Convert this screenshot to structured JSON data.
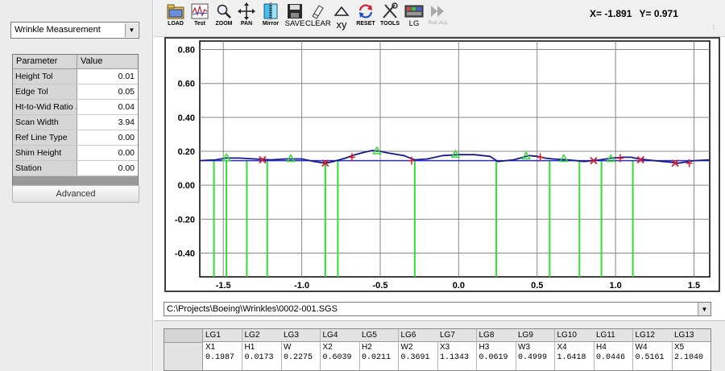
{
  "mode_select": {
    "value": "Wrinkle Measurement"
  },
  "param_table": {
    "headers": [
      "Parameter",
      "Value"
    ],
    "rows": [
      {
        "name": "Height Tol",
        "value": "0.01"
      },
      {
        "name": "Edge Tol",
        "value": "0.05"
      },
      {
        "name": "Ht-to-Wid Ratio ...",
        "value": "0.04"
      },
      {
        "name": "Scan Width",
        "value": "3.94"
      },
      {
        "name": "Ref Line Type",
        "value": "0.00"
      },
      {
        "name": "Shim Height",
        "value": "0.00"
      },
      {
        "name": "Station",
        "value": "0.00"
      }
    ]
  },
  "advanced_label": "Advanced",
  "toolbar": {
    "tools": [
      {
        "id": "load",
        "label": "LOAD",
        "icon": "folder-icon"
      },
      {
        "id": "test",
        "label": "Test",
        "icon": "signal-wave-icon"
      },
      {
        "id": "zoom",
        "label": "ZOOM",
        "icon": "magnifier-icon"
      },
      {
        "id": "pan",
        "label": "PAN",
        "icon": "four-arrows-icon"
      },
      {
        "id": "mirror",
        "label": "Mirror",
        "icon": "mirror-icon"
      },
      {
        "id": "save",
        "label": "SAVE",
        "icon": "floppy-disk-icon"
      },
      {
        "id": "clear",
        "label": "CLEAR",
        "icon": "eraser-icon"
      },
      {
        "id": "xy",
        "label": "xy",
        "icon": "triangle-icon"
      },
      {
        "id": "reset",
        "label": "RESET",
        "icon": "refresh-arrows-icon"
      },
      {
        "id": "tools",
        "label": "TOOLS",
        "icon": "tools-icon"
      },
      {
        "id": "lg",
        "label": "LG",
        "icon": "lg-panel-icon"
      },
      {
        "id": "run_all",
        "label": "Run ALL",
        "icon": "fast-forward-icon"
      }
    ],
    "coord_x": "X= -1.891",
    "coord_y": "Y= 0.971"
  },
  "file_path": "C:\\Projects\\Boeing\\Wrinkles\\0002-001.SGS",
  "results": {
    "columns": [
      {
        "lg": "LG1",
        "name": "X1",
        "value": "0.1987"
      },
      {
        "lg": "LG2",
        "name": "H1",
        "value": "0.0173"
      },
      {
        "lg": "LG3",
        "name": "W",
        "value": "0.2275"
      },
      {
        "lg": "LG4",
        "name": "X2",
        "value": "0.6039"
      },
      {
        "lg": "LG5",
        "name": "H2",
        "value": "0.0211"
      },
      {
        "lg": "LG6",
        "name": "W2",
        "value": "0.3691"
      },
      {
        "lg": "LG7",
        "name": "X3",
        "value": "1.1343"
      },
      {
        "lg": "LG8",
        "name": "H3",
        "value": "0.0619"
      },
      {
        "lg": "LG9",
        "name": "W3",
        "value": "0.4999"
      },
      {
        "lg": "LG10",
        "name": "X4",
        "value": "1.6418"
      },
      {
        "lg": "LG11",
        "name": "H4",
        "value": "0.0446"
      },
      {
        "lg": "LG12",
        "name": "W4",
        "value": "0.5161"
      },
      {
        "lg": "LG13",
        "name": "X5",
        "value": "2.1040"
      }
    ]
  },
  "colors": {
    "profile": "#1a1a8c",
    "reference_line": "#2a2ae0",
    "green": "#33dd33",
    "red": "#d81b2a",
    "grid": "#888888"
  },
  "chart_data": {
    "type": "line",
    "xlim": [
      -1.65,
      1.6
    ],
    "ylim": [
      -0.54,
      0.85
    ],
    "x_ticks": [
      "-1.5",
      "-1.0",
      "-0.5",
      "0.0",
      "0.5",
      "1.0",
      "1.5"
    ],
    "x_tick_values": [
      -1.5,
      -1.0,
      -0.5,
      0.0,
      0.5,
      1.0,
      1.5
    ],
    "y_ticks": [
      "0.80",
      "0.60",
      "0.40",
      "0.20",
      "0.00",
      "-0.20",
      "-0.40"
    ],
    "y_tick_values": [
      0.8,
      0.6,
      0.4,
      0.2,
      0.0,
      -0.2,
      -0.4
    ],
    "grid": true,
    "profile": {
      "x": [
        -1.65,
        -1.55,
        -1.48,
        -1.4,
        -1.3,
        -1.2,
        -1.1,
        -1.0,
        -0.92,
        -0.85,
        -0.8,
        -0.72,
        -0.66,
        -0.6,
        -0.55,
        -0.5,
        -0.45,
        -0.35,
        -0.28,
        -0.2,
        -0.1,
        0.0,
        0.1,
        0.2,
        0.25,
        0.3,
        0.35,
        0.45,
        0.5,
        0.55,
        0.6,
        0.7,
        0.8,
        0.85,
        0.9,
        0.98,
        1.05,
        1.1,
        1.15,
        1.2,
        1.3,
        1.36,
        1.4,
        1.5,
        1.6
      ],
      "y": [
        0.145,
        0.15,
        0.16,
        0.16,
        0.155,
        0.15,
        0.155,
        0.155,
        0.14,
        0.13,
        0.14,
        0.16,
        0.18,
        0.195,
        0.205,
        0.2,
        0.19,
        0.175,
        0.15,
        0.155,
        0.175,
        0.18,
        0.18,
        0.17,
        0.14,
        0.145,
        0.15,
        0.175,
        0.17,
        0.16,
        0.155,
        0.15,
        0.14,
        0.145,
        0.15,
        0.16,
        0.165,
        0.165,
        0.155,
        0.15,
        0.14,
        0.135,
        0.13,
        0.145,
        0.15
      ]
    },
    "reference_line": {
      "x": [
        -1.65,
        1.6
      ],
      "y": [
        0.145,
        0.145
      ]
    },
    "green_lines": [
      -1.56,
      -1.48,
      -1.35,
      -1.22,
      -0.85,
      -0.77,
      -0.28,
      0.24,
      0.58,
      0.77,
      0.91,
      1.11
    ],
    "green_lines_bottom": -0.54,
    "green_markers": [
      {
        "x": -1.48,
        "y": 0.16
      },
      {
        "x": -1.07,
        "y": 0.155
      },
      {
        "x": -0.52,
        "y": 0.2
      },
      {
        "x": -0.02,
        "y": 0.18
      },
      {
        "x": 0.43,
        "y": 0.17
      },
      {
        "x": 0.67,
        "y": 0.155
      },
      {
        "x": 0.97,
        "y": 0.155
      }
    ],
    "red_x_markers": [
      {
        "x": -1.25,
        "y": 0.15
      },
      {
        "x": -0.85,
        "y": 0.13
      },
      {
        "x": 0.86,
        "y": 0.145
      },
      {
        "x": 1.16,
        "y": 0.15
      },
      {
        "x": 1.38,
        "y": 0.13
      }
    ],
    "red_tick_markers": [
      {
        "x": -0.68,
        "y": 0.165
      },
      {
        "x": -0.3,
        "y": 0.145
      },
      {
        "x": 0.52,
        "y": 0.165
      },
      {
        "x": 1.03,
        "y": 0.16
      },
      {
        "x": 1.47,
        "y": 0.13
      }
    ]
  }
}
